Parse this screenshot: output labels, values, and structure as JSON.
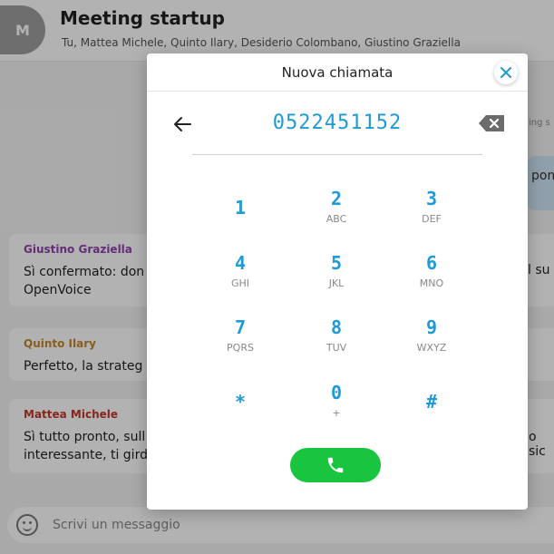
{
  "chat": {
    "avatar_initial": "M",
    "title": "Meeting startup",
    "members": "Tu, Mattea Michele, Quinto Ilary, Desiderio Colombano, Giustino Graziella",
    "meta_partial": "ing s",
    "sent_partial": "pom",
    "messages": [
      {
        "author": "Giustino Graziella",
        "author_color": "#8e44ad",
        "text_line1": "Sì confermato: don",
        "text_line2": "OpenVoice",
        "right_fragment": "l su"
      },
      {
        "author": "Quinto Ilary",
        "author_color": "#c8862a",
        "text_line1": "Perfetto, la strateg",
        "text_line2": "",
        "right_fragment": ""
      },
      {
        "author": "Mattea Michele",
        "author_color": "#c0392b",
        "text_line1": "Sì tutto pronto, sull",
        "text_line2": "interessante, ti gird",
        "right_fragment": "o sic"
      }
    ],
    "composer_placeholder": "Scrivi un messaggio"
  },
  "dialer": {
    "title": "Nuova chiamata",
    "number": "0522451152",
    "keys": [
      {
        "digit": "1",
        "letters": ""
      },
      {
        "digit": "2",
        "letters": "ABC"
      },
      {
        "digit": "3",
        "letters": "DEF"
      },
      {
        "digit": "4",
        "letters": "GHI"
      },
      {
        "digit": "5",
        "letters": "JKL"
      },
      {
        "digit": "6",
        "letters": "MNO"
      },
      {
        "digit": "7",
        "letters": "PQRS"
      },
      {
        "digit": "8",
        "letters": "TUV"
      },
      {
        "digit": "9",
        "letters": "WXYZ"
      },
      {
        "digit": "*",
        "letters": ""
      },
      {
        "digit": "0",
        "letters": "+"
      },
      {
        "digit": "#",
        "letters": ""
      }
    ]
  },
  "colors": {
    "accent": "#1e9ad6",
    "call_green": "#19c43f"
  },
  "icons": {
    "back": "arrow-left-icon",
    "backspace": "backspace-icon",
    "close": "close-icon",
    "call": "phone-icon",
    "emoji": "emoji-icon"
  }
}
